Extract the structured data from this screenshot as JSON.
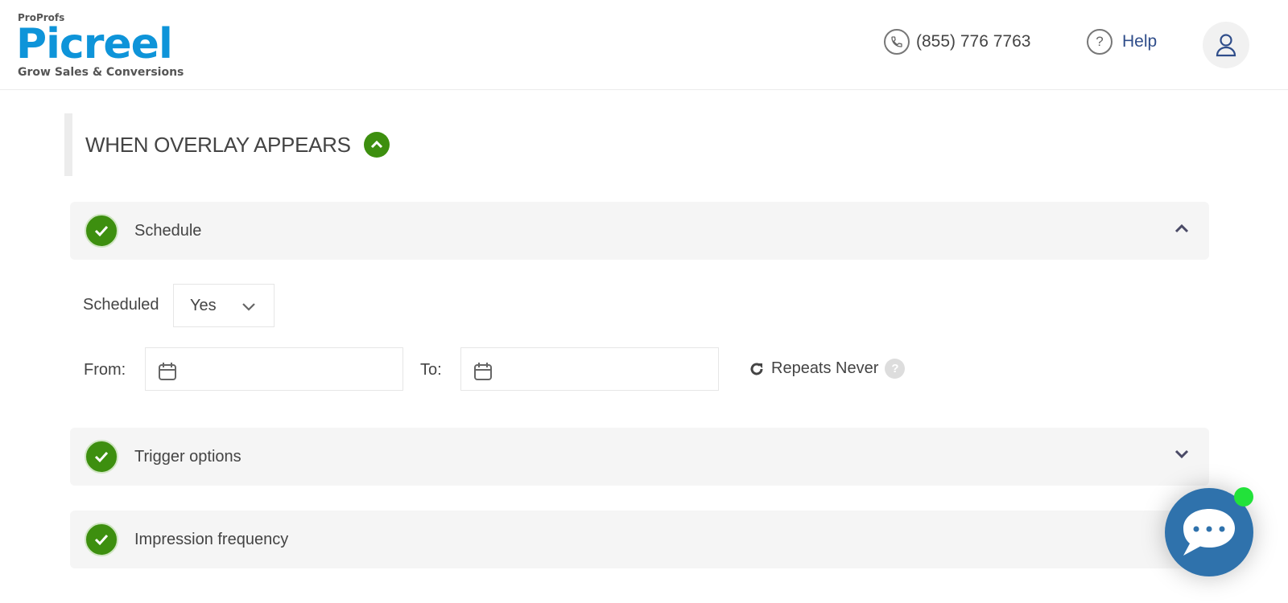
{
  "brand": {
    "parent": "ProProfs",
    "name": "Picreel",
    "tagline": "Grow Sales & Conversions",
    "color": "#0e94d9"
  },
  "header": {
    "phone": "(855) 776 7763",
    "help": "Help"
  },
  "section": {
    "title": "WHEN OVERLAY APPEARS",
    "expanded": true
  },
  "accordions": [
    {
      "label": "Schedule",
      "expanded": true,
      "complete": true
    },
    {
      "label": "Trigger options",
      "expanded": false,
      "complete": true
    },
    {
      "label": "Impression frequency",
      "expanded": false,
      "complete": true
    }
  ],
  "schedule": {
    "scheduled_label": "Scheduled",
    "scheduled_value": "Yes",
    "from_label": "From:",
    "from_value": "",
    "to_label": "To:",
    "to_value": "",
    "repeats": "Repeats Never"
  },
  "colors": {
    "accent_green": "#3d8f0f",
    "chat_blue": "#2f72ac",
    "online_green": "#22e23a",
    "help_blue": "#2f4d8a"
  }
}
